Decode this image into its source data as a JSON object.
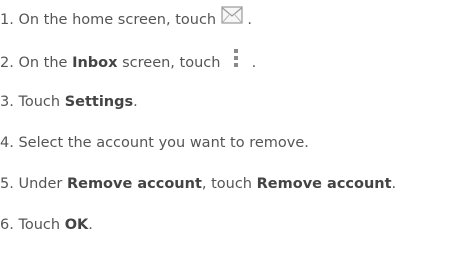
{
  "steps": [
    {
      "number": "1.",
      "before": "On the home screen, touch",
      "icon": "mail-icon",
      "after": "."
    },
    {
      "number": "2.",
      "before": "On the",
      "bold1": "Inbox",
      "middle": "screen, touch",
      "icon": "overflow-menu-icon",
      "after": "."
    },
    {
      "number": "3.",
      "before": "Touch",
      "bold1": "Settings",
      "after": "."
    },
    {
      "number": "4.",
      "before": "Select the account you want to remove."
    },
    {
      "number": "5.",
      "before": "Under",
      "bold1": "Remove account",
      "middle": ", touch",
      "bold2": "Remove account",
      "after": "."
    },
    {
      "number": "6.",
      "before": "Touch",
      "bold1": "OK",
      "after": "."
    }
  ],
  "colors": {
    "text": "#555555",
    "bold_text": "#444444",
    "icon_gray": "#888888",
    "icon_light": "#cccccc"
  }
}
